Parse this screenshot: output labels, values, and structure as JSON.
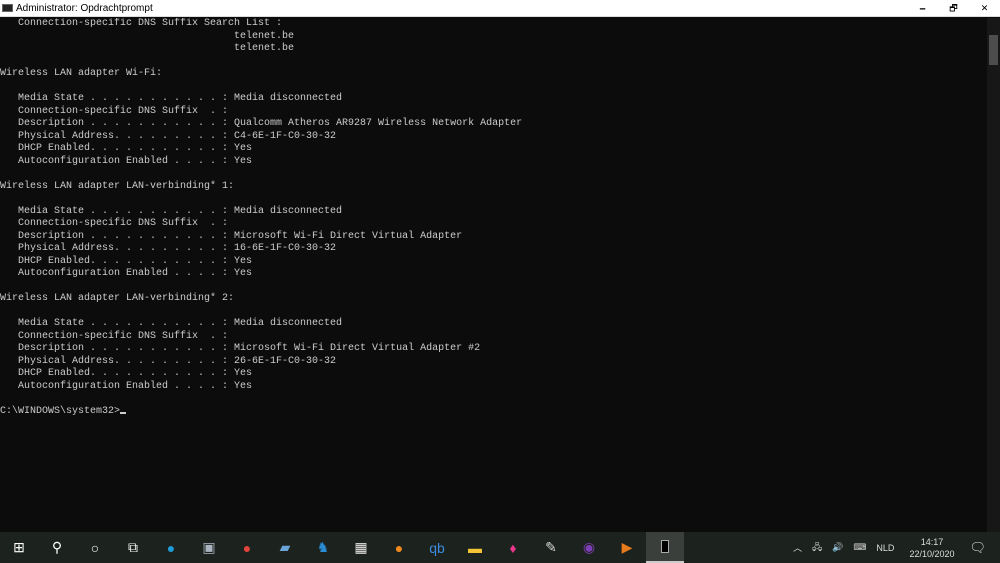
{
  "window": {
    "title": "Administrator: Opdrachtprompt",
    "minimize": "🗕",
    "maximize": "🗗",
    "close": "✕"
  },
  "console": {
    "lines": [
      "   Connection-specific DNS Suffix Search List :",
      "                                       telenet.be",
      "                                       telenet.be",
      "",
      "Wireless LAN adapter Wi-Fi:",
      "",
      "   Media State . . . . . . . . . . . : Media disconnected",
      "   Connection-specific DNS Suffix  . :",
      "   Description . . . . . . . . . . . : Qualcomm Atheros AR9287 Wireless Network Adapter",
      "   Physical Address. . . . . . . . . : C4-6E-1F-C0-30-32",
      "   DHCP Enabled. . . . . . . . . . . : Yes",
      "   Autoconfiguration Enabled . . . . : Yes",
      "",
      "Wireless LAN adapter LAN-verbinding* 1:",
      "",
      "   Media State . . . . . . . . . . . : Media disconnected",
      "   Connection-specific DNS Suffix  . :",
      "   Description . . . . . . . . . . . : Microsoft Wi-Fi Direct Virtual Adapter",
      "   Physical Address. . . . . . . . . : 16-6E-1F-C0-30-32",
      "   DHCP Enabled. . . . . . . . . . . : Yes",
      "   Autoconfiguration Enabled . . . . : Yes",
      "",
      "Wireless LAN adapter LAN-verbinding* 2:",
      "",
      "   Media State . . . . . . . . . . . : Media disconnected",
      "   Connection-specific DNS Suffix  . :",
      "   Description . . . . . . . . . . . : Microsoft Wi-Fi Direct Virtual Adapter #2",
      "   Physical Address. . . . . . . . . : 26-6E-1F-C0-30-32",
      "   DHCP Enabled. . . . . . . . . . . : Yes",
      "   Autoconfiguration Enabled . . . . : Yes",
      ""
    ],
    "prompt": "C:\\WINDOWS\\system32>"
  },
  "taskbar": {
    "apps": [
      {
        "name": "start-button",
        "glyph": "⊞",
        "color": "#ffffff"
      },
      {
        "name": "search-button",
        "glyph": "⚲",
        "color": "#ffffff"
      },
      {
        "name": "cortana-button",
        "glyph": "○",
        "color": "#ffffff"
      },
      {
        "name": "task-view-button",
        "glyph": "⧉",
        "color": "#ffffff"
      },
      {
        "name": "edge-app",
        "glyph": "●",
        "color": "#1e9ad6"
      },
      {
        "name": "computer-app",
        "glyph": "▣",
        "color": "#aab4c0"
      },
      {
        "name": "chrome-app",
        "glyph": "●",
        "color": "#e0443a"
      },
      {
        "name": "remote-app",
        "glyph": "▰",
        "color": "#6aa3d8"
      },
      {
        "name": "app-blue",
        "glyph": "♞",
        "color": "#2b8fd8"
      },
      {
        "name": "store-app",
        "glyph": "▦",
        "color": "#e8e8e8"
      },
      {
        "name": "vpn-app",
        "glyph": "●",
        "color": "#f08a1c"
      },
      {
        "name": "qbittorrent-app",
        "glyph": "qb",
        "color": "#3d8ce0"
      },
      {
        "name": "file-explorer-app",
        "glyph": "▬",
        "color": "#f2c335"
      },
      {
        "name": "flame-app",
        "glyph": "♦",
        "color": "#e8368c"
      },
      {
        "name": "paint-app",
        "glyph": "✎",
        "color": "#d8d8d8"
      },
      {
        "name": "tor-app",
        "glyph": "◉",
        "color": "#7d3fb5"
      },
      {
        "name": "media-player-app",
        "glyph": "▶",
        "color": "#e87b1c"
      },
      {
        "name": "cmd-app",
        "glyph": "■",
        "color": "#000000"
      }
    ],
    "tray": {
      "chevron": "︿",
      "network": "🖧",
      "volume": "🔊",
      "keyboard": "⌨",
      "language": "NLD",
      "time": "14:17",
      "date": "22/10/2020",
      "notifications": "🗨"
    }
  }
}
